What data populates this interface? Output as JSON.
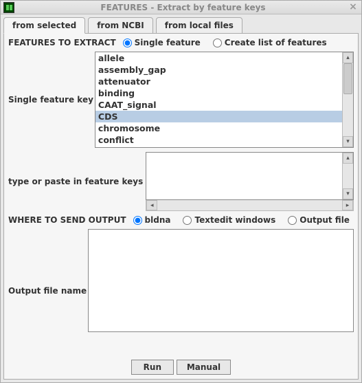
{
  "window": {
    "title": "FEATURES - Extract by feature keys"
  },
  "tabs": [
    {
      "label": "from selected",
      "active": true
    },
    {
      "label": "from NCBI",
      "active": false
    },
    {
      "label": "from local files",
      "active": false
    }
  ],
  "features_section": {
    "label": "FEATURES TO EXTRACT",
    "options": {
      "single": "Single feature",
      "list": "Create list of features",
      "selected": "single"
    }
  },
  "single_feature": {
    "label": "Single feature key",
    "items": [
      "allele",
      "assembly_gap",
      "attenuator",
      "binding",
      "CAAT_signal",
      "CDS",
      "chromosome",
      "conflict"
    ],
    "selected": "CDS"
  },
  "paste_keys": {
    "label": "type or paste in feature keys",
    "value": ""
  },
  "output_section": {
    "label": "WHERE TO SEND OUTPUT",
    "options": {
      "bldna": "bldna",
      "textedit": "Textedit windows",
      "file": "Output file",
      "selected": "bldna"
    }
  },
  "output_file": {
    "label": "Output file name",
    "value": ""
  },
  "buttons": {
    "run": "Run",
    "manual": "Manual"
  }
}
